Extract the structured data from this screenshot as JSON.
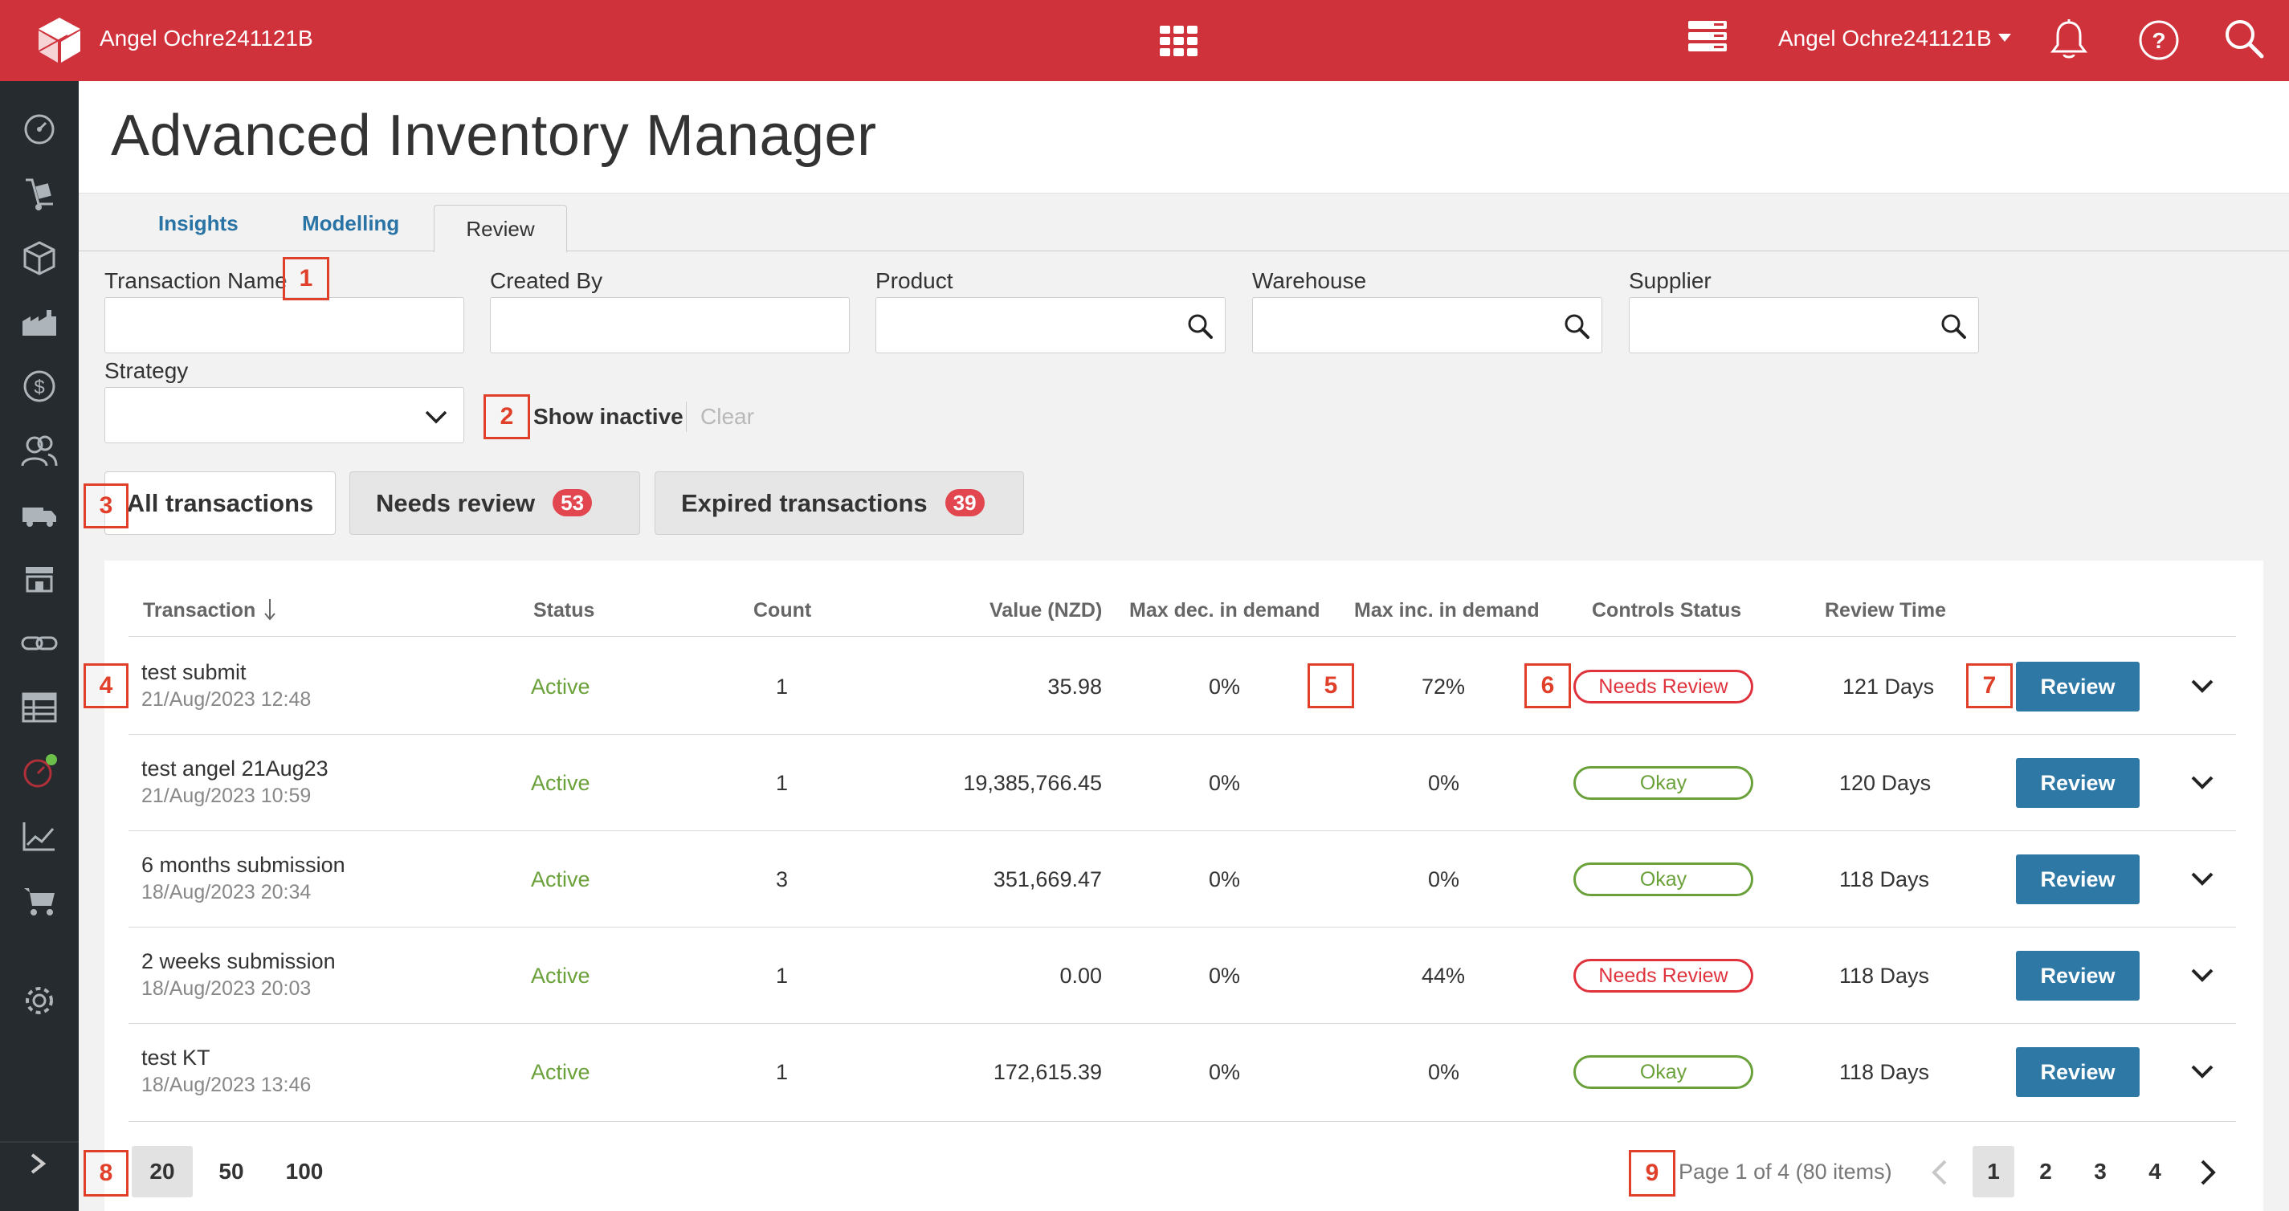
{
  "header": {
    "brand": "Angel Ochre241121B",
    "user": "Angel Ochre241121B",
    "icons": [
      "cube-logo",
      "apps-grid-icon",
      "server-icon",
      "bell-icon",
      "help-icon",
      "search-icon"
    ]
  },
  "sidebar": {
    "items": [
      "dashboard-icon",
      "dolly-icon",
      "box-icon",
      "factory-icon",
      "dollar-icon",
      "users-icon",
      "truck-icon",
      "store-icon",
      "link-icon",
      "table-icon",
      "gauge-icon",
      "chart-icon",
      "cart-icon",
      "settings-icon"
    ],
    "expand": "chevron-right-icon"
  },
  "page": {
    "title": "Advanced Inventory Manager"
  },
  "tabs": [
    {
      "label": "Insights"
    },
    {
      "label": "Modelling"
    },
    {
      "label": "Review"
    }
  ],
  "filters": {
    "transaction_name": "Transaction Name",
    "created_by": "Created By",
    "product": "Product",
    "warehouse": "Warehouse",
    "supplier": "Supplier",
    "strategy": "Strategy",
    "show_inactive": "Show inactive",
    "clear": "Clear"
  },
  "segments": {
    "all": "All transactions",
    "needs_review": "Needs review",
    "needs_review_count": "53",
    "expired": "Expired transactions",
    "expired_count": "39"
  },
  "table": {
    "headers": {
      "transaction": "Transaction",
      "status": "Status",
      "count": "Count",
      "value": "Value (NZD)",
      "max_dec": "Max dec. in demand",
      "max_inc": "Max inc. in demand",
      "controls": "Controls Status",
      "review_time": "Review Time"
    },
    "review_label": "Review",
    "rows": [
      {
        "name": "test submit",
        "date": "21/Aug/2023 12:48",
        "status": "Active",
        "count": "1",
        "value": "35.98",
        "max_dec": "0%",
        "max_inc": "72%",
        "controls": "Needs Review",
        "review_time": "121 Days"
      },
      {
        "name": "test angel 21Aug23",
        "date": "21/Aug/2023 10:59",
        "status": "Active",
        "count": "1",
        "value": "19,385,766.45",
        "max_dec": "0%",
        "max_inc": "0%",
        "controls": "Okay",
        "review_time": "120 Days"
      },
      {
        "name": "6 months submission",
        "date": "18/Aug/2023 20:34",
        "status": "Active",
        "count": "3",
        "value": "351,669.47",
        "max_dec": "0%",
        "max_inc": "0%",
        "controls": "Okay",
        "review_time": "118 Days"
      },
      {
        "name": "2 weeks submission",
        "date": "18/Aug/2023 20:03",
        "status": "Active",
        "count": "1",
        "value": "0.00",
        "max_dec": "0%",
        "max_inc": "44%",
        "controls": "Needs Review",
        "review_time": "118 Days"
      },
      {
        "name": "test KT",
        "date": "18/Aug/2023 13:46",
        "status": "Active",
        "count": "1",
        "value": "172,615.39",
        "max_dec": "0%",
        "max_inc": "0%",
        "controls": "Okay",
        "review_time": "118 Days"
      }
    ]
  },
  "pagination": {
    "sizes": [
      "20",
      "50",
      "100"
    ],
    "info": "Page 1 of 4 (80 items)",
    "pages": [
      "1",
      "2",
      "3",
      "4"
    ]
  },
  "markers": [
    "1",
    "2",
    "3",
    "4",
    "5",
    "6",
    "7",
    "8",
    "9"
  ],
  "colors": {
    "topbar": "#d0323c",
    "sidebar": "#252b2f",
    "link": "#2a73a5",
    "active_green": "#6aa13b",
    "needs_review_red": "#e0323c",
    "review_button": "#2e78a6",
    "marker": "#e0402a"
  }
}
